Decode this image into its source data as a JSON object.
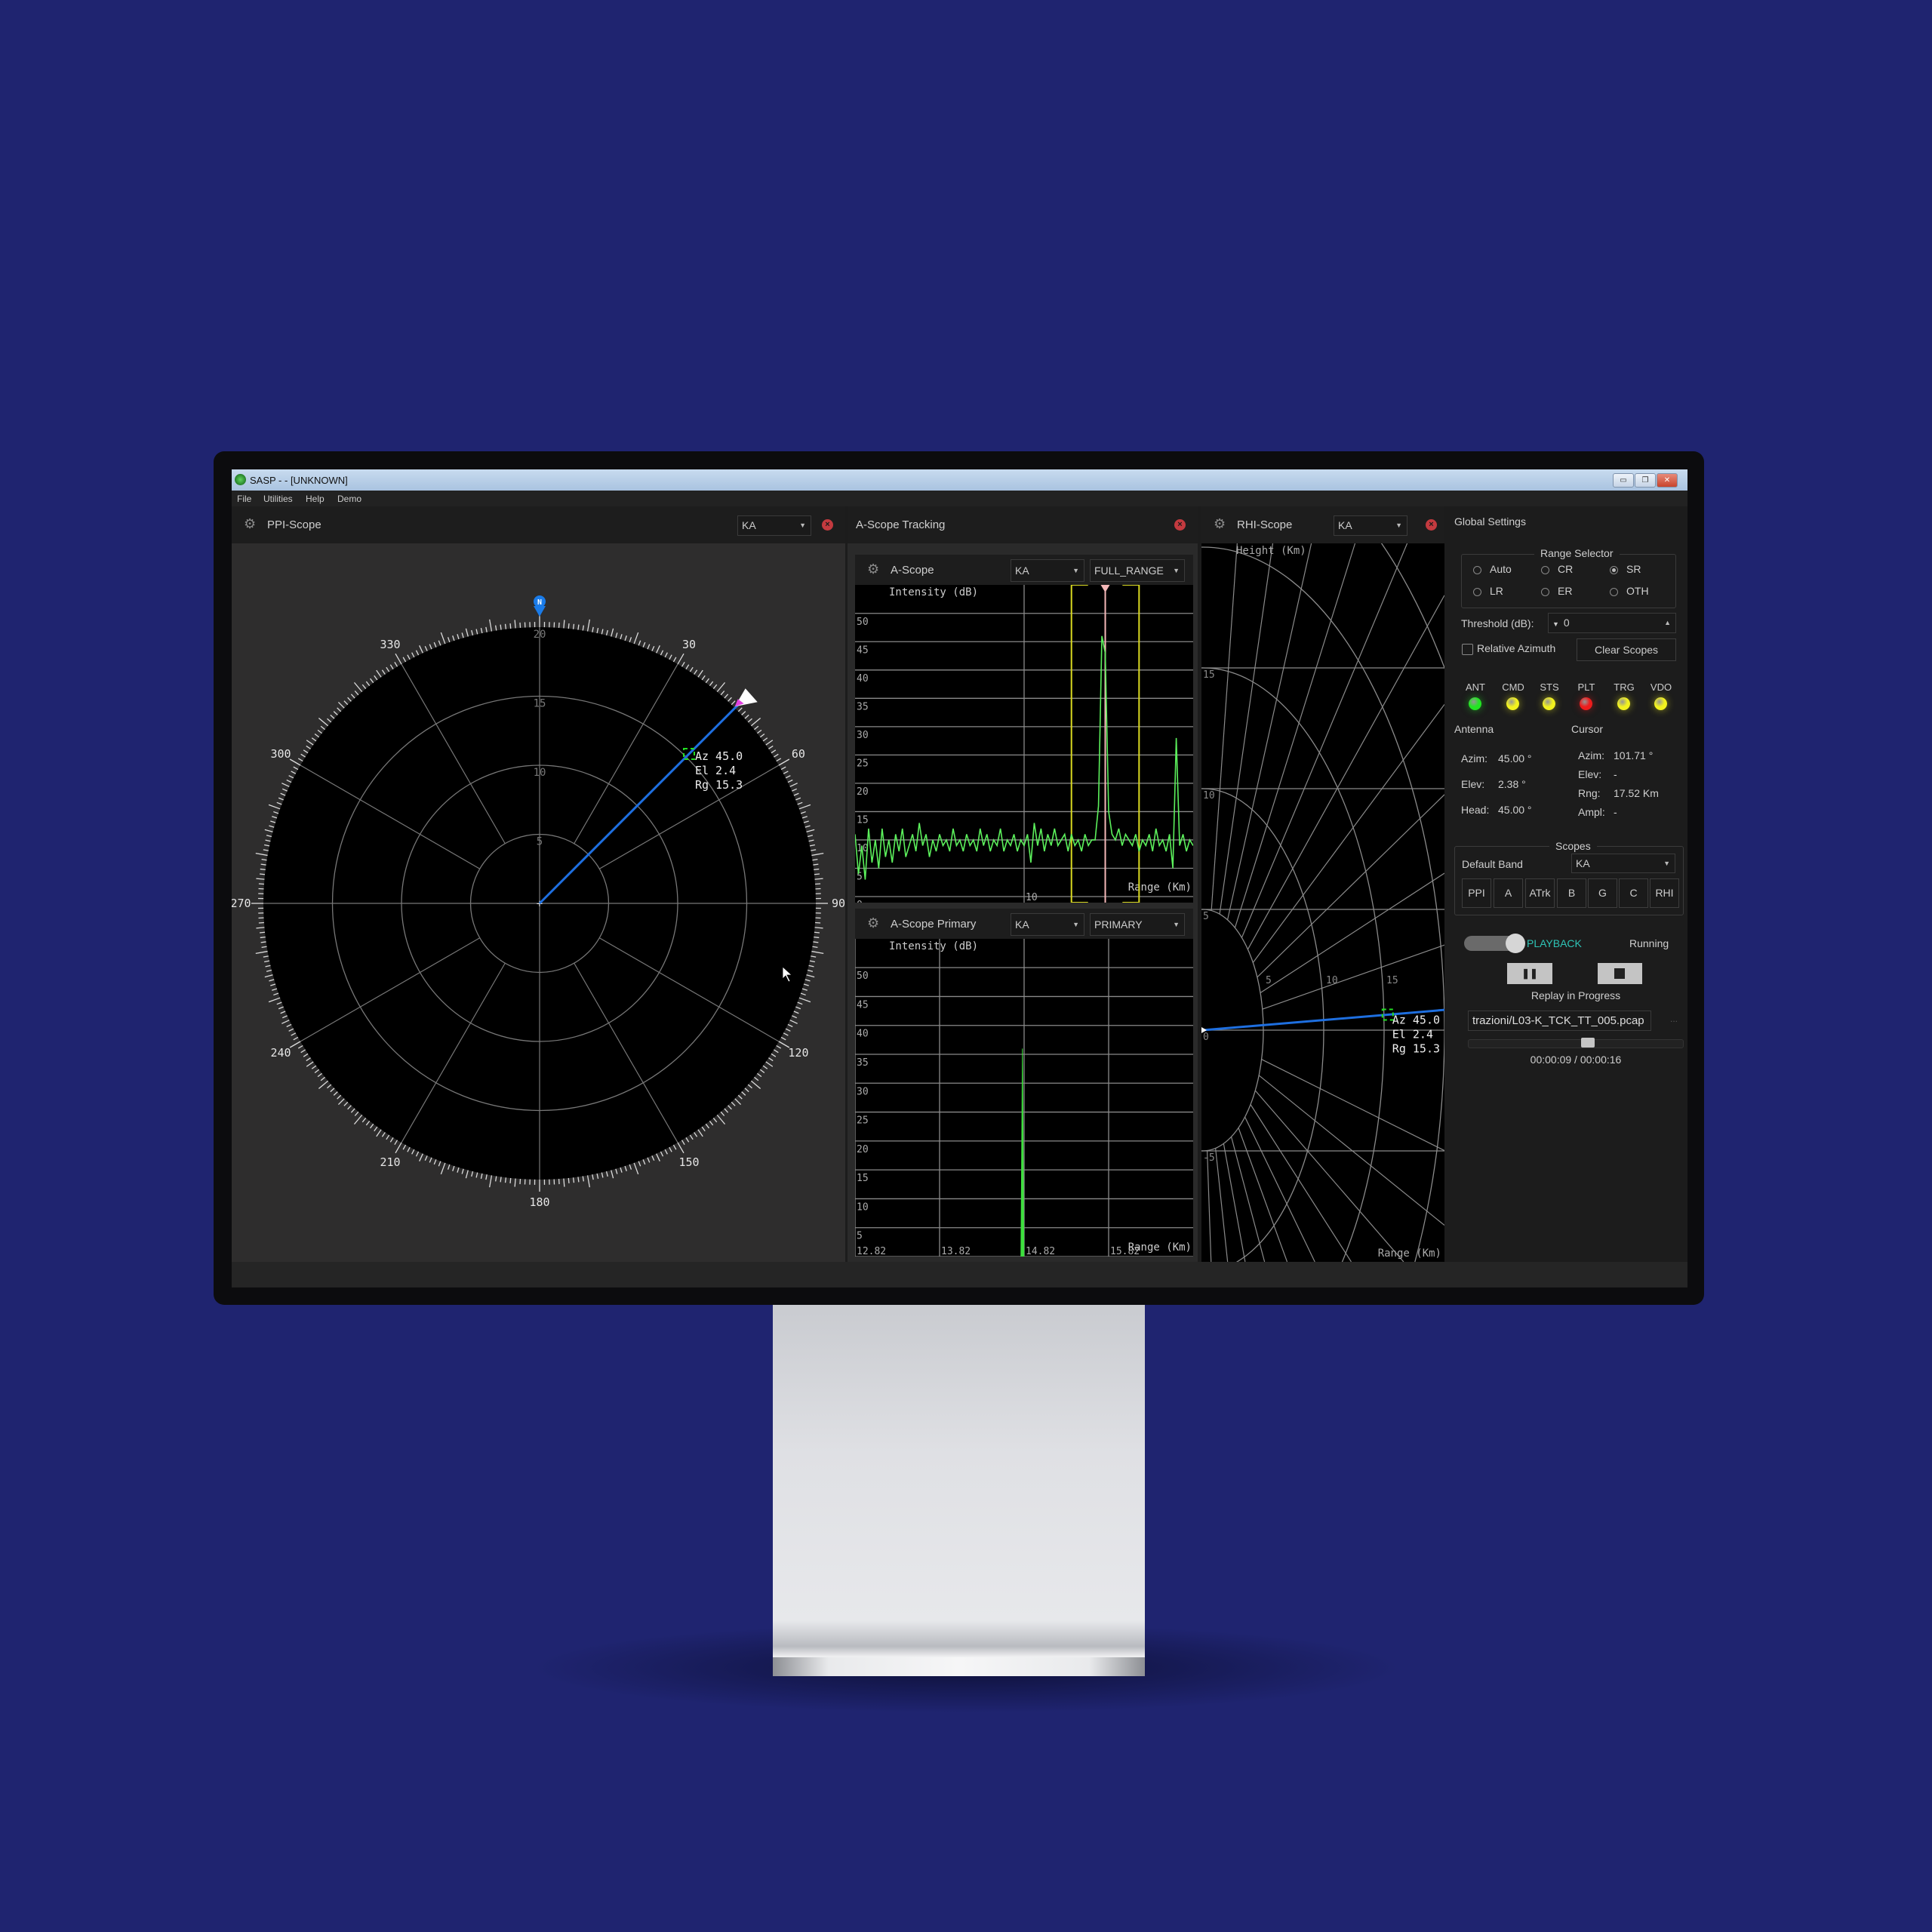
{
  "window": {
    "title": "SASP - - [UNKNOWN]",
    "controls": [
      "minimize",
      "restore",
      "close"
    ]
  },
  "menu": [
    "File",
    "Utilities",
    "Help",
    "Demo"
  ],
  "ppi": {
    "title": "PPI-Scope",
    "band": "KA",
    "range_rings": [
      5,
      10,
      15,
      20
    ],
    "azimuth_labels": [
      30,
      60,
      90,
      120,
      150,
      180,
      210,
      240,
      270,
      300,
      330
    ],
    "north_marker": "N",
    "target": {
      "az_label": "Az 45.0",
      "el_label": "El 2.4",
      "rg_label": "Rg 15.3",
      "az": 45.0,
      "rg": 15.3
    },
    "antenna_azimuth": 45.0,
    "colors": {
      "beam": "#1e6fe0",
      "target_box": "#22dd22",
      "north": "#1a7be8",
      "marker": "#e040e0"
    }
  },
  "atrack": {
    "title": "A-Scope Tracking"
  },
  "ascope": {
    "title": "A-Scope",
    "band": "KA",
    "mode": "FULL_RANGE"
  },
  "aprimary": {
    "title": "A-Scope Primary",
    "band": "KA",
    "mode": "PRIMARY"
  },
  "rhi": {
    "title": "RHI-Scope",
    "band": "KA",
    "ylabel": "Height (Km)",
    "xlabel": "Range (Km)",
    "height_ticks": [
      15,
      10,
      5,
      0,
      -5
    ],
    "range_ticks": [
      5,
      10,
      15
    ],
    "target": {
      "az_label": "Az 45.0",
      "el_label": "El 2.4",
      "rg_label": "Rg 15.3",
      "el": 2.4,
      "rg": 15.3
    }
  },
  "chart_data": [
    {
      "type": "line",
      "ylabel": "Intensity (dB)",
      "xlabel": "Range (Km)",
      "xlim": [
        0,
        20
      ],
      "ylim": [
        0,
        52.5
      ],
      "grid": true,
      "x_ticks": [
        10
      ],
      "y_ticks": [
        0,
        5,
        10,
        15,
        20,
        25,
        30,
        35,
        40,
        45,
        50
      ],
      "gate": [
        12.8,
        16.8
      ],
      "cursor": 14.8,
      "color": "#5cf05c",
      "x_step": 0.2,
      "values": [
        11,
        4,
        9,
        3,
        12,
        6,
        10,
        5,
        12,
        7,
        10,
        6,
        11,
        8,
        12,
        7,
        9,
        11,
        8,
        13,
        9,
        11,
        7,
        10,
        8,
        11,
        9,
        10,
        8,
        12,
        9,
        10,
        8,
        11,
        9,
        10,
        8,
        12,
        9,
        11,
        8,
        10,
        9,
        12,
        8,
        10,
        9,
        11,
        8,
        10,
        9,
        11,
        6,
        13,
        9,
        12,
        8,
        11,
        9,
        12,
        9,
        10,
        11,
        8,
        11,
        9,
        10,
        8,
        11,
        9,
        10,
        10,
        16,
        46,
        43,
        15,
        11,
        10,
        12,
        9,
        11,
        10,
        9,
        11,
        8,
        10,
        9,
        11,
        8,
        12,
        9,
        10,
        8,
        11,
        5,
        28,
        9,
        11,
        8,
        10,
        9
      ]
    },
    {
      "type": "line",
      "ylabel": "Intensity (dB)",
      "xlabel": "Range (Km)",
      "xlim": [
        12.82,
        16.82
      ],
      "ylim": [
        0,
        52.5
      ],
      "grid": true,
      "x_ticks": [
        12.82,
        13.82,
        14.82,
        15.82
      ],
      "y_ticks": [
        5,
        10,
        15,
        20,
        25,
        30,
        35,
        40,
        45,
        50
      ],
      "color": "#3ee03e",
      "peaks": [
        {
          "x": 14.8,
          "y": 36
        }
      ]
    }
  ],
  "settings": {
    "title": "Global Settings",
    "range_selector": {
      "title": "Range Selector",
      "options": [
        "Auto",
        "CR",
        "SR",
        "LR",
        "ER",
        "OTH"
      ],
      "selected": "SR"
    },
    "threshold": {
      "label": "Threshold (dB):",
      "value": "0"
    },
    "relative_azimuth": {
      "label": "Relative Azimuth",
      "checked": false
    },
    "clear_scopes": "Clear Scopes",
    "leds": [
      {
        "label": "ANT",
        "color": "#22e622"
      },
      {
        "label": "CMD",
        "color": "#f2f21e"
      },
      {
        "label": "STS",
        "color": "#f2f21e"
      },
      {
        "label": "PLT",
        "color": "#ee1c1c"
      },
      {
        "label": "TRG",
        "color": "#f2f21e"
      },
      {
        "label": "VDO",
        "color": "#f2f21e"
      }
    ],
    "antenna": {
      "title": "Antenna",
      "azim_label": "Azim:",
      "azim": "45.00 °",
      "elev_label": "Elev:",
      "elev": "2.38 °",
      "head_label": "Head:",
      "head": "45.00 °"
    },
    "cursor": {
      "title": "Cursor",
      "azim_label": "Azim:",
      "azim": "101.71 °",
      "elev_label": "Elev:",
      "elev": "-",
      "rng_label": "Rng:",
      "rng": "17.52 Km",
      "ampl_label": "Ampl:",
      "ampl": "-"
    },
    "scopes": {
      "title": "Scopes",
      "default_band_label": "Default Band",
      "default_band": "KA",
      "buttons": [
        "PPI",
        "A",
        "ATrk",
        "B",
        "G",
        "C",
        "RHI"
      ]
    },
    "playback": {
      "mode": "PLAYBACK",
      "status": "Running",
      "mode_color": "#2ec4b6",
      "info": "Replay in Progress",
      "file": "trazioni/L03-K_TCK_TT_005.pcap",
      "browse": "...",
      "time": "00:00:09 / 00:00:16",
      "progress": 0.56
    }
  }
}
